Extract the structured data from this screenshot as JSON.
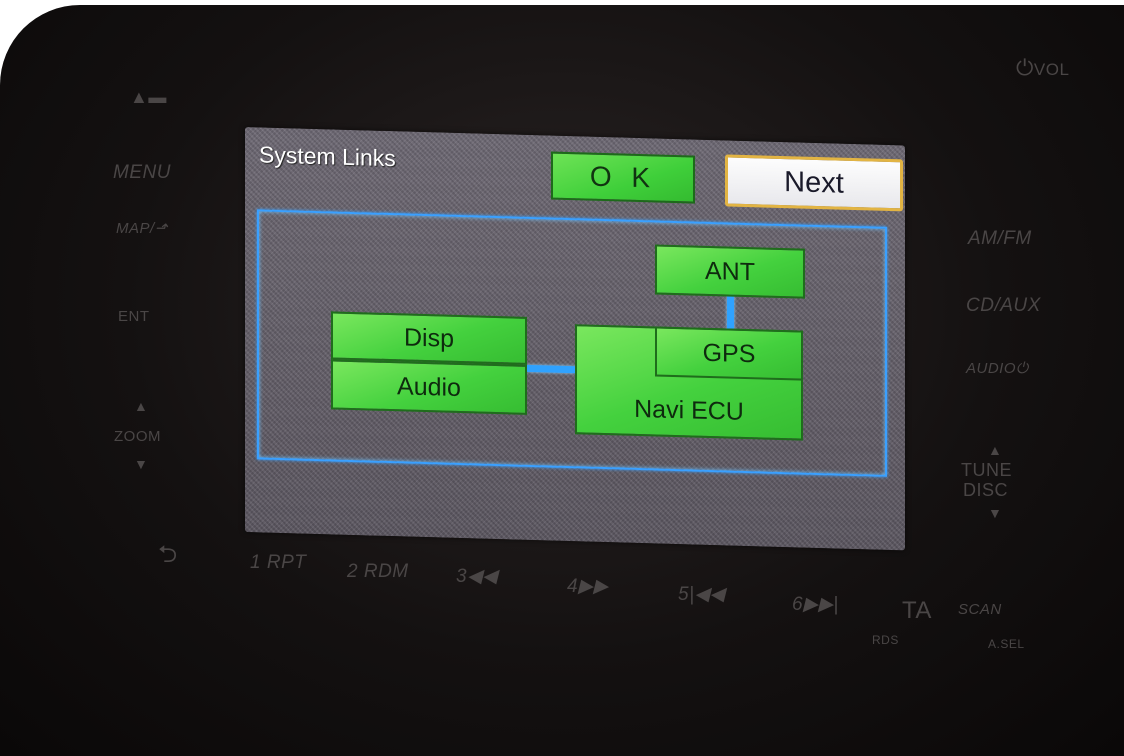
{
  "bezel": {
    "eject_icon": "eject-icon",
    "power_icon": "power-icon",
    "vol_label": "VOL",
    "menu_label": "MENU",
    "map_label": "MAP/",
    "ent_label": "ENT",
    "zoom_label": "ZOOM",
    "am_fm_label": "AM/FM",
    "cd_aux_label": "CD/AUX",
    "audio_label": "AUDIO",
    "tune_label": "TUNE",
    "disc_label": "DISC",
    "back_icon": "back-arrow-icon",
    "preset_1": "1 RPT",
    "preset_2": "2 RDM",
    "preset_3": "3",
    "preset_4": "4",
    "preset_5": "5",
    "preset_6": "6",
    "ta_label": "TA",
    "rds_label": "RDS",
    "scan_label": "SCAN",
    "asel_label": "A.SEL"
  },
  "screen": {
    "title": "System Links",
    "ok_label": "O K",
    "next_label": "Next",
    "nodes": {
      "ant": "ANT",
      "gps": "GPS",
      "disp": "Disp",
      "audio": "Audio",
      "navi": "Navi ECU"
    }
  },
  "colors": {
    "node_green": "#44d13e",
    "link_blue": "#2fa2ff",
    "next_border": "#e2b443"
  }
}
